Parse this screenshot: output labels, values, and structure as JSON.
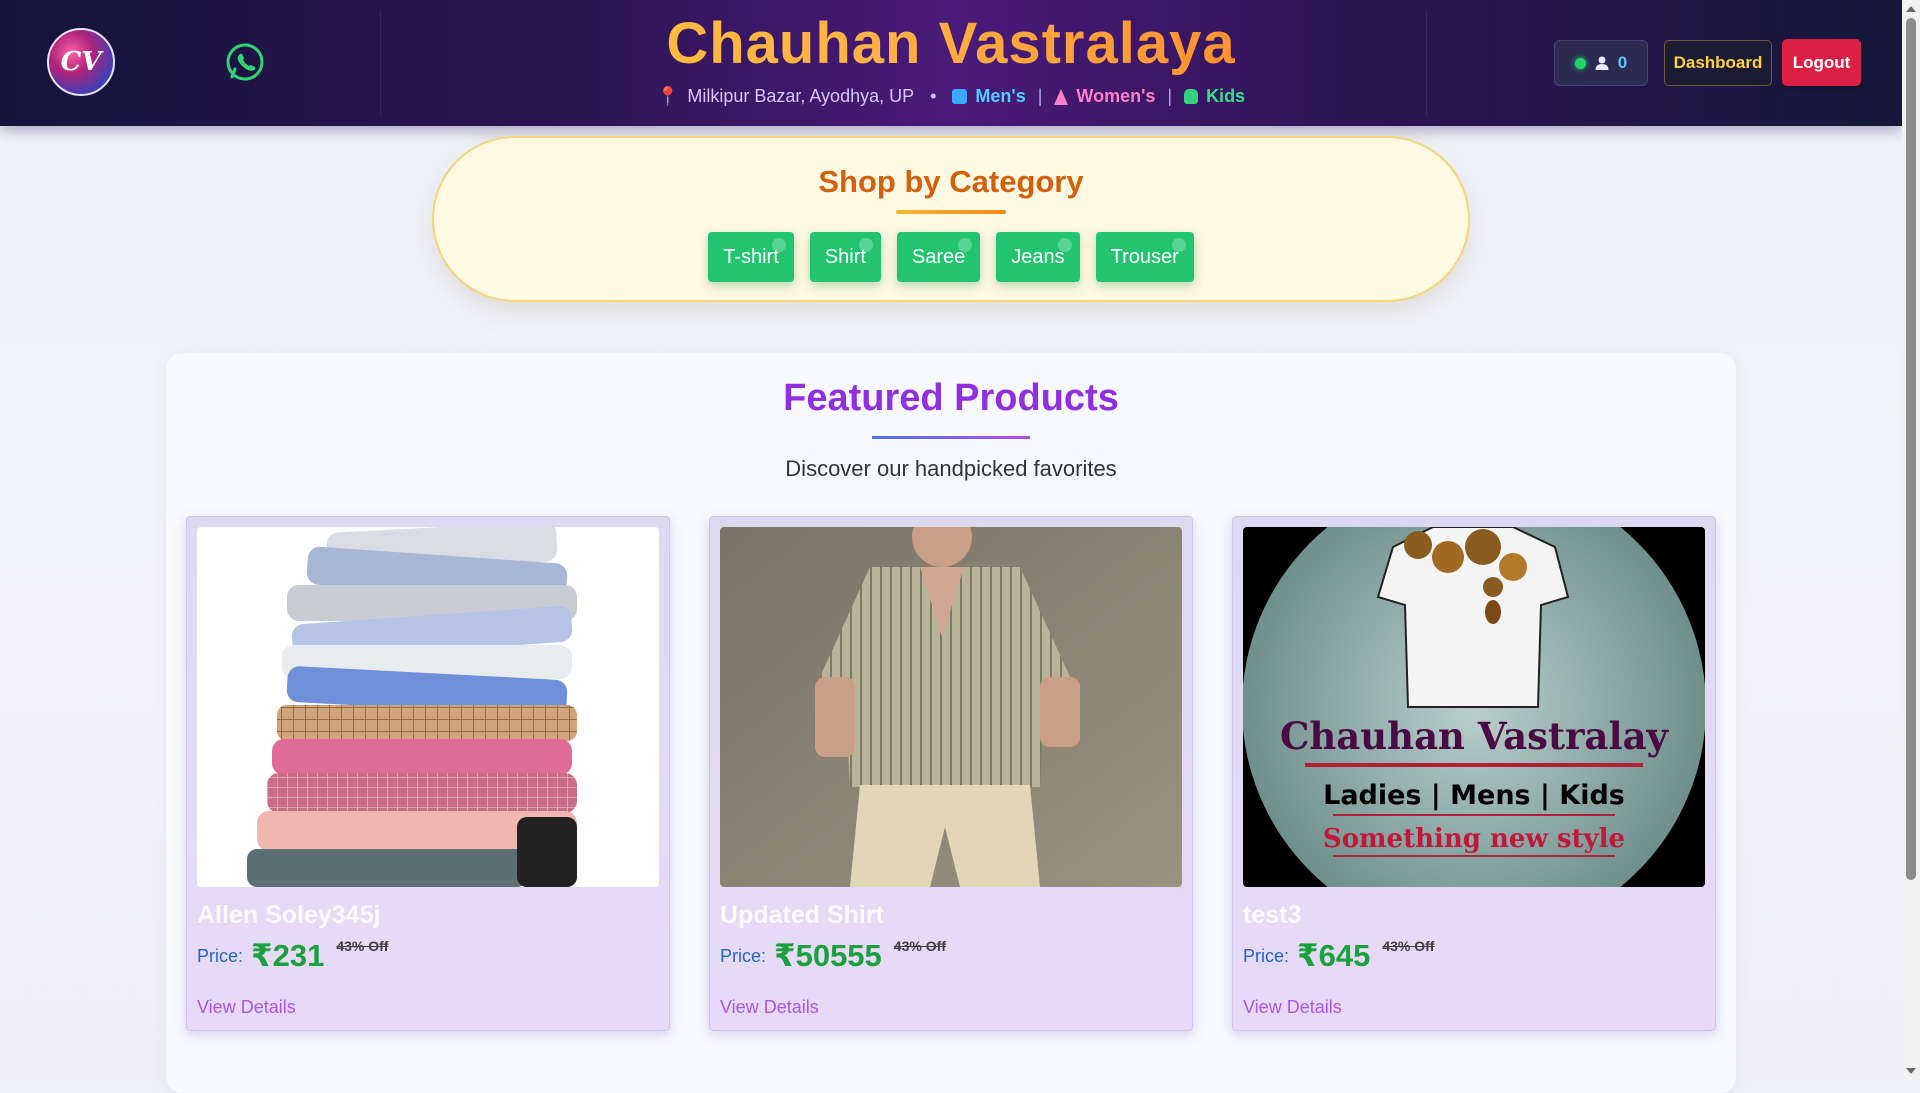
{
  "header": {
    "logo_text": "CV",
    "brand_title": "Chauhan Vastralaya",
    "location": "Milkipur Bazar, Ayodhya, UP",
    "categories": [
      {
        "label": "Men's",
        "icon": "shirt-icon",
        "color": "#4fd1ff"
      },
      {
        "label": "Women's",
        "icon": "dress-icon",
        "color": "#ff7fc8"
      },
      {
        "label": "Kids",
        "icon": "kids-icon",
        "color": "#38e089"
      }
    ],
    "status_count": "0",
    "dashboard_label": "Dashboard",
    "logout_label": "Logout"
  },
  "shop_by_category": {
    "title": "Shop by Category",
    "buttons": [
      "T-shirt",
      "Shirt",
      "Saree",
      "Jeans",
      "Trouser"
    ]
  },
  "featured": {
    "title": "Featured Products",
    "subtitle": "Discover our handpicked favorites",
    "price_label": "Price:",
    "view_details_label": "View Details",
    "products": [
      {
        "name": "Allen Soley345j",
        "price": "₹231",
        "discount": "43% Off",
        "image": "stacked-shirts-image"
      },
      {
        "name": "Updated Shirt",
        "price": "₹50555",
        "discount": "43% Off",
        "image": "model-striped-shirt-image"
      },
      {
        "name": "test3",
        "price": "₹645",
        "discount": "43% Off",
        "image": "brand-banner-image",
        "image_text": {
          "line1": "Chauhan Vastralay",
          "line2": "Ladies | Mens | Kids",
          "line3": "Something new style"
        }
      }
    ]
  },
  "colors": {
    "accent_orange": "#d3610c",
    "accent_purple": "#8f2fe0",
    "category_button": "#22c470",
    "logout": "#dc1f45",
    "price_green": "#1aa03c"
  }
}
